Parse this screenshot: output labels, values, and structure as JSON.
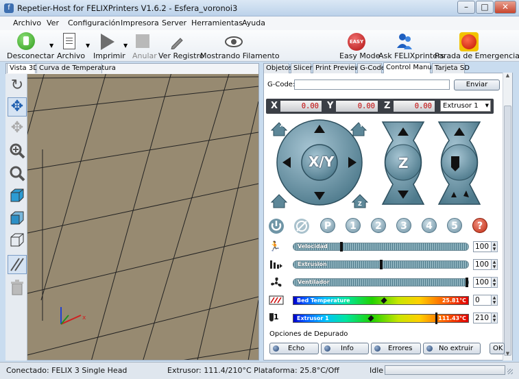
{
  "window": {
    "title": "Repetier-Host for FELIXPrinters V1.6.2 - Esfera_voronoi3",
    "icon": "f"
  },
  "menu": [
    "Archivo",
    "Ver",
    "Configuración",
    "Impresora",
    "Server",
    "Herramientas",
    "Ayuda"
  ],
  "toolbar": {
    "disconnect": "Desconectar",
    "archivo": "Archivo",
    "imprimir": "Imprimir",
    "anular": "Anular",
    "registro": "Ver Registro",
    "filamento": "Mostrando Filamento",
    "easy": "Easy Mode",
    "easy_badge": "EASY",
    "ask": "Ask FELIXprinters",
    "emergency": "Parada de Emergencia"
  },
  "left_tabs": [
    "Vista 3D",
    "Curva de Temperatura"
  ],
  "right_tabs": [
    "Objetos",
    "Slicer",
    "Print Preview",
    "G-Code",
    "Control Manual",
    "Tarjeta SD"
  ],
  "gcode": {
    "label": "G-Code:",
    "value": "",
    "send": "Enviar"
  },
  "coords": {
    "x_label": "X",
    "x": "0.00",
    "y_label": "Y",
    "y": "0.00",
    "z_label": "Z",
    "z": "0.00",
    "extruder": "Extrusor 1"
  },
  "jog": {
    "xy": "X/Y",
    "z": "Z",
    "home_x": "X",
    "home_y": "Y",
    "home_z": "Z"
  },
  "presets": [
    "1",
    "2",
    "3",
    "4",
    "5"
  ],
  "preset_p": "P",
  "help": "?",
  "sliders": {
    "speed_label": "Velocidad",
    "speed": "100",
    "speed_frac": 0.27,
    "extrusion_label": "Extrusion",
    "extrusion": "100",
    "extrusion_frac": 0.5,
    "fan_label": "Ventilador",
    "fan": "100",
    "fan_frac": 1.0
  },
  "temps": {
    "bed_label": "Bed Temperature",
    "bed_reading": "25.81°C",
    "bed_target": "0",
    "bed_frac": 0.52,
    "ext_label": "Extrusor 1",
    "ext_reading": "111.43°C",
    "ext_target": "210",
    "ext_frac": 0.44,
    "ext_marker_frac": 0.82,
    "ext_num": "1"
  },
  "debug": {
    "title": "Opciones de Depurado",
    "echo": "Echo",
    "info": "Info",
    "errors": "Errores",
    "noextrude": "No extruir",
    "ok": "OK"
  },
  "status": {
    "connected": "Conectado: FELIX 3 Single Head",
    "temps": "Extrusor: 111.4/210°C Plataforma: 25.8°C/Off",
    "state": "Idle"
  }
}
